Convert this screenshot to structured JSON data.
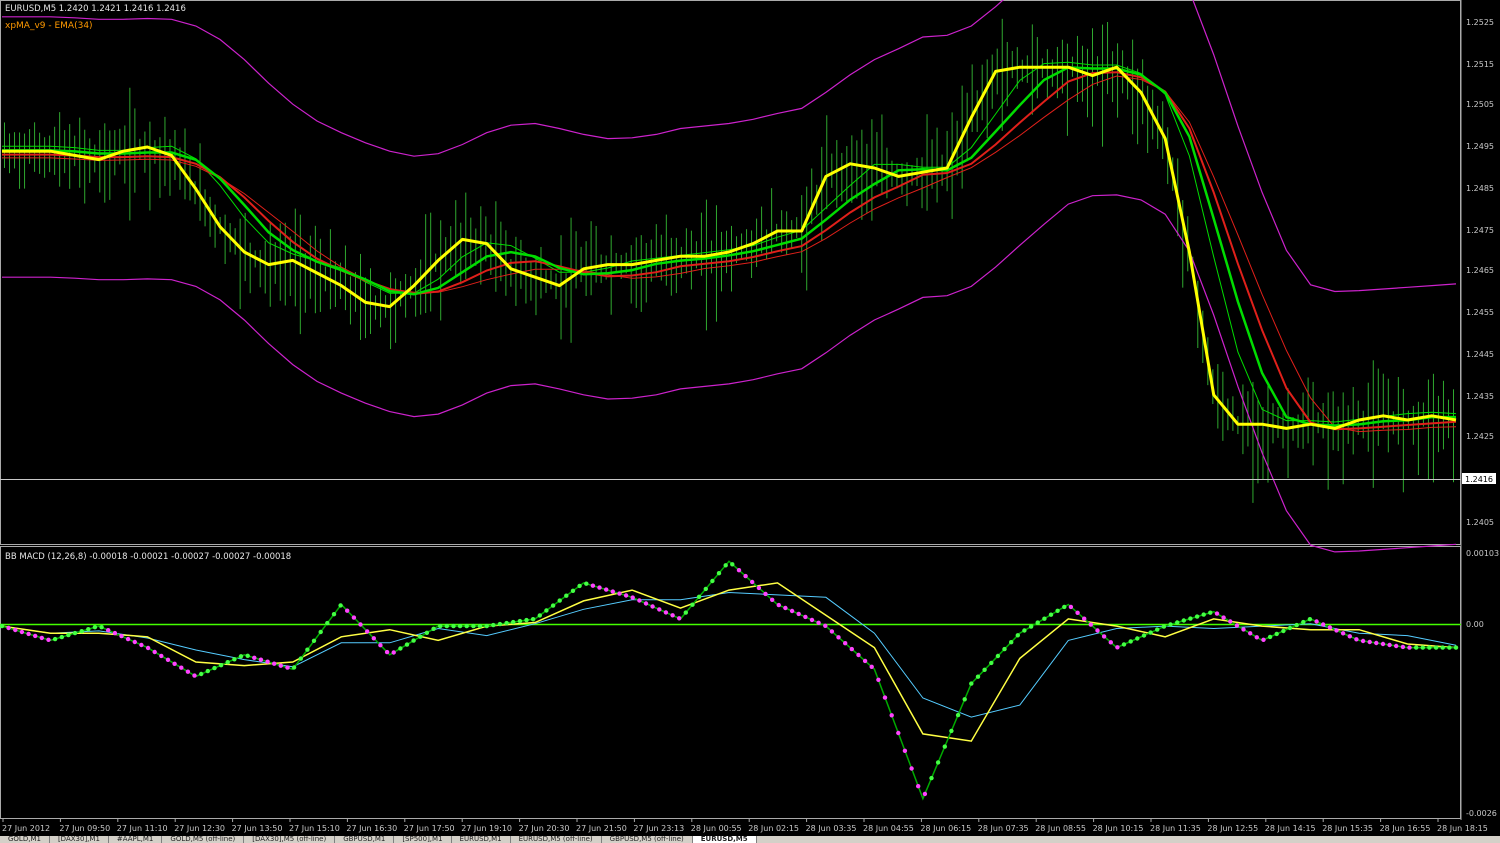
{
  "header": {
    "symbol_line": "EURUSD,M5  1.2420 1.2421 1.2416 1.2416",
    "indicator_label": "xpMA_v9 - EMA(34)"
  },
  "price_axis": {
    "labels": [
      "1.2525",
      "1.2515",
      "1.2505",
      "1.2495",
      "1.2485",
      "1.2475",
      "1.2465",
      "1.2455",
      "1.2445",
      "1.2435",
      "1.2425",
      "1.2405"
    ],
    "current_price": "1.2416"
  },
  "macd": {
    "label": "BB MACD (12,26,8) -0.00018 -0.00021 -0.00027 -0.00027 -0.00018",
    "axis_top": "0.00103",
    "axis_zero": "0.00",
    "axis_bottom": "-0.0026"
  },
  "time_axis": {
    "labels": [
      "27 Jun 2012",
      "27 Jun 09:50",
      "27 Jun 11:10",
      "27 Jun 12:30",
      "27 Jun 13:50",
      "27 Jun 15:10",
      "27 Jun 16:30",
      "27 Jun 17:50",
      "27 Jun 19:10",
      "27 Jun 20:30",
      "27 Jun 21:50",
      "27 Jun 23:13",
      "28 Jun 00:55",
      "28 Jun 02:15",
      "28 Jun 03:35",
      "28 Jun 04:55",
      "28 Jun 06:15",
      "28 Jun 07:35",
      "28 Jun 08:55",
      "28 Jun 10:15",
      "28 Jun 11:35",
      "28 Jun 12:55",
      "28 Jun 14:15",
      "28 Jun 15:35",
      "28 Jun 16:55",
      "28 Jun 18:15"
    ]
  },
  "tabs": [
    "GOLD,M1",
    "[DAX30],M1",
    "#AAPL,M1",
    "GOLD,M5 (off-line)",
    "[DAX30],M5 (off-line)",
    "GBPUSD,M1",
    "[SP500],M1",
    "EURUSD,M1",
    "EURUSD,M5 (off-line)",
    "GBPUSD,M5 (off-line)",
    "EURUSD,M5"
  ],
  "colors": {
    "background": "#000000",
    "bars": "#2fa82f",
    "xpma": "#ffff00",
    "ema_green": "#00dd00",
    "ema_red": "#e0201a",
    "bands": "#cc22cc",
    "macd_up": "#44ff44",
    "macd_down": "#ff44ff",
    "zero_line": "#44ff00",
    "signal_yellow": "#ffff44",
    "signal_blue": "#55ccff"
  },
  "chart_data": [
    {
      "type": "line",
      "title": "EURUSD,M5",
      "ylim": [
        1.2398,
        1.253
      ],
      "x": [
        0,
        5,
        10,
        15,
        20,
        25,
        30,
        35,
        40,
        45,
        50,
        55,
        60,
        65,
        70,
        75,
        80,
        85,
        90,
        95,
        100,
        105,
        110,
        115,
        120,
        125,
        130,
        135,
        140,
        145,
        150,
        155,
        160,
        165,
        170,
        175,
        180,
        185,
        190,
        195,
        200,
        205,
        210,
        215,
        220,
        225,
        230,
        235,
        240,
        245,
        250,
        255,
        260,
        265,
        270,
        275,
        280,
        285,
        290,
        295,
        300
      ],
      "series": [
        {
          "name": "xpMA_v9 - EMA(34)",
          "values": [
            1.2494,
            1.2494,
            1.2494,
            1.2493,
            1.2492,
            1.2494,
            1.2495,
            1.2493,
            1.2485,
            1.2476,
            1.247,
            1.2467,
            1.2468,
            1.2465,
            1.2462,
            1.2458,
            1.2457,
            1.2462,
            1.2468,
            1.2473,
            1.2472,
            1.2466,
            1.2464,
            1.2462,
            1.2466,
            1.2467,
            1.2467,
            1.2468,
            1.2469,
            1.2469,
            1.247,
            1.2472,
            1.2475,
            1.2475,
            1.2488,
            1.2491,
            1.249,
            1.2488,
            1.2489,
            1.249,
            1.2502,
            1.2513,
            1.2514,
            1.2514,
            1.2514,
            1.2512,
            1.2514,
            1.2508,
            1.2497,
            1.247,
            1.2436,
            1.2429,
            1.2429,
            1.2428,
            1.2429,
            1.2428,
            1.243,
            1.2431,
            1.243,
            1.2431,
            1.243
          ]
        }
      ]
    },
    {
      "type": "line",
      "title": "BB MACD (12,26,8)",
      "ylim": [
        -0.0026,
        0.00103
      ],
      "x": [
        0,
        10,
        20,
        30,
        40,
        50,
        60,
        70,
        80,
        90,
        100,
        110,
        120,
        130,
        140,
        150,
        160,
        170,
        180,
        190,
        200,
        210,
        220,
        230,
        240,
        250,
        260,
        270,
        280,
        290,
        300
      ],
      "series": [
        {
          "name": "BB MACD",
          "values": [
            0.0,
            -0.0002,
            0.0,
            -0.0003,
            -0.0007,
            -0.0004,
            -0.0006,
            0.0003,
            -0.0004,
            0.0,
            0.0,
            0.0001,
            0.0006,
            0.0004,
            0.0001,
            0.0009,
            0.0003,
            0.0,
            -0.0006,
            -0.0024,
            -0.0008,
            -0.0001,
            0.0003,
            -0.0003,
            0.0,
            0.0002,
            -0.0002,
            0.0001,
            -0.0002,
            -0.0003,
            -0.0003
          ]
        }
      ]
    }
  ]
}
